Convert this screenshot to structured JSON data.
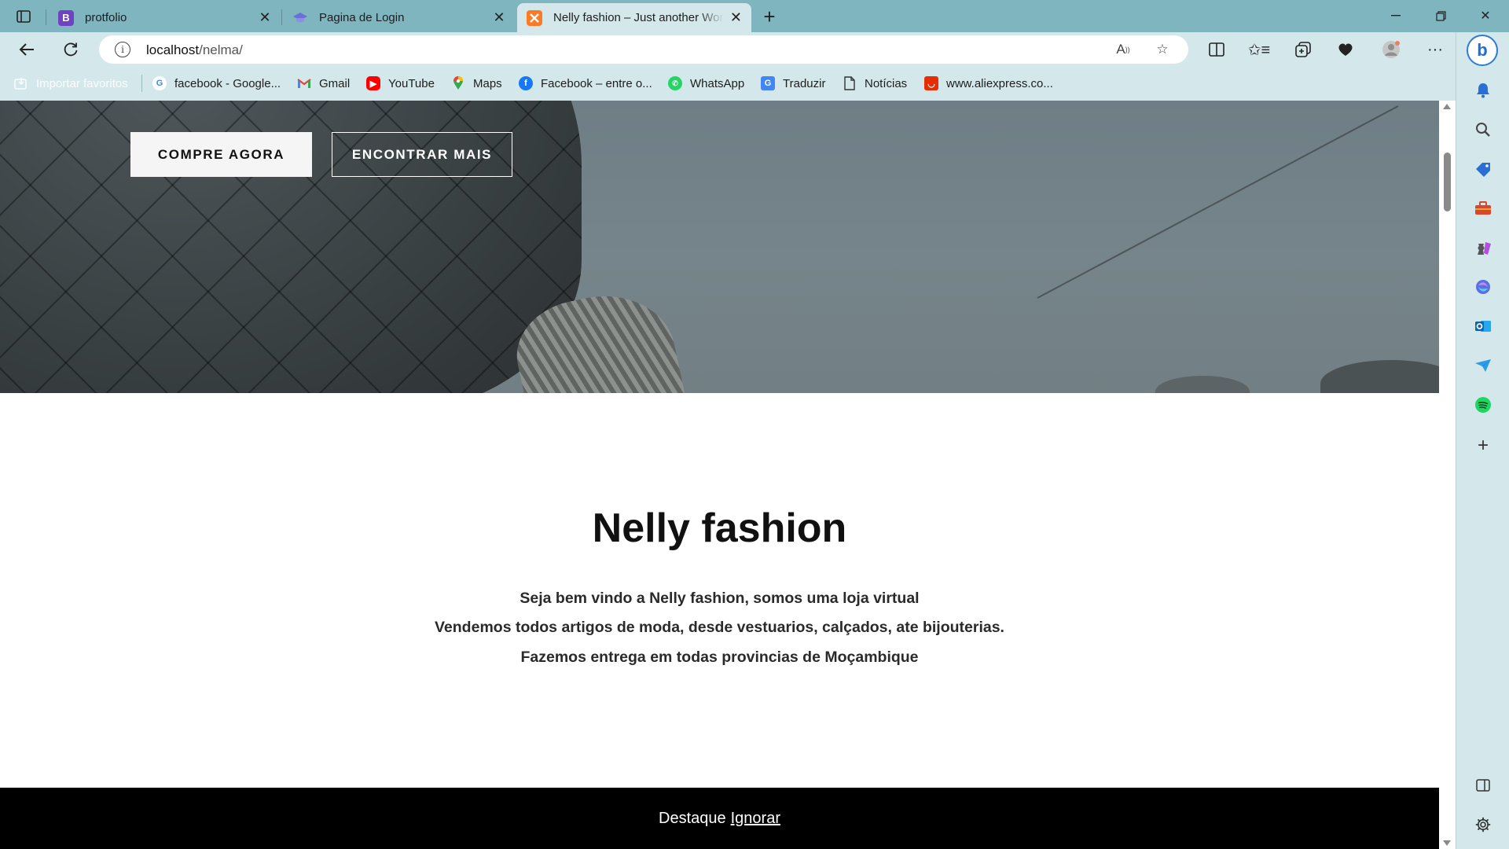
{
  "browser": {
    "tabs": [
      {
        "label": "protfolio",
        "favicon": "bootstrap-icon",
        "favicon_letter": "B"
      },
      {
        "label": "Pagina de Login",
        "favicon": "graduation-cap-icon"
      },
      {
        "label": "Nelly fashion – Just another WordPress site",
        "favicon": "xampp-icon",
        "active": true
      }
    ],
    "url": {
      "host": "localhost",
      "path": "/nelma/"
    },
    "favorites": [
      {
        "label": "Importar favoritos",
        "icon": "import-icon"
      },
      {
        "label": "facebook - Google...",
        "icon": "google-icon"
      },
      {
        "label": "Gmail",
        "icon": "gmail-icon"
      },
      {
        "label": "YouTube",
        "icon": "youtube-icon"
      },
      {
        "label": "Maps",
        "icon": "maps-icon"
      },
      {
        "label": "Facebook – entre o...",
        "icon": "facebook-icon"
      },
      {
        "label": "WhatsApp",
        "icon": "whatsapp-icon"
      },
      {
        "label": "Traduzir",
        "icon": "translate-icon"
      },
      {
        "label": "Notícias",
        "icon": "document-icon"
      },
      {
        "label": "www.aliexpress.co...",
        "icon": "aliexpress-icon"
      }
    ],
    "colors": {
      "frame": "#7fb5bf",
      "toolbar": "#d4e8ec"
    }
  },
  "hero": {
    "primary_button": "COMPRE AGORA",
    "secondary_button": "ENCONTRAR MAIS"
  },
  "intro": {
    "title": "Nelly fashion",
    "lines": [
      "Seja bem vindo a Nelly fashion, somos uma loja virtual",
      "Vendemos todos artigos de moda, desde vestuarios, calçados, ate bijouterias.",
      "Fazemos entrega em todas provincias de Moçambique"
    ]
  },
  "notice": {
    "text": "Destaque",
    "dismiss": "Ignorar"
  }
}
